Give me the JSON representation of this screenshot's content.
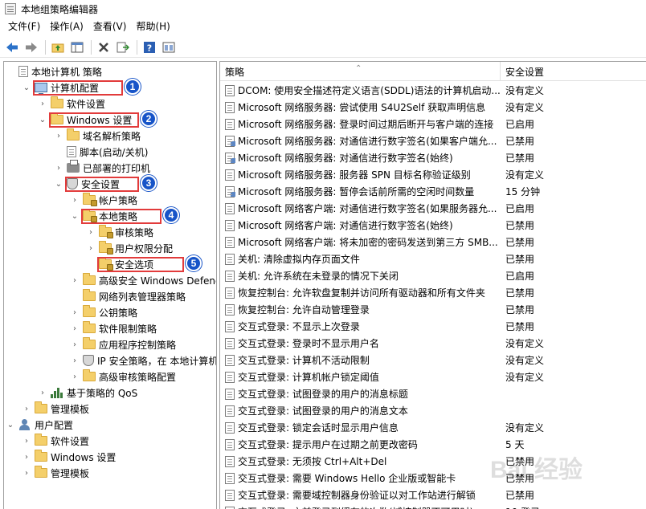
{
  "window": {
    "title": "本地组策略编辑器"
  },
  "menu": [
    "文件(F)",
    "操作(A)",
    "查看(V)",
    "帮助(H)"
  ],
  "toolbar": [
    "back-icon",
    "forward-icon",
    "up-folder-icon",
    "show-hide-tree-icon",
    "delete-icon",
    "export-icon",
    "help-icon",
    "properties-icon"
  ],
  "tree": [
    {
      "label": "本地计算机 策略",
      "icon": "doc-icon",
      "level": 0,
      "twisty": ""
    },
    {
      "label": "计算机配置",
      "icon": "pc-icon",
      "level": 1,
      "twisty": "open",
      "badge": "1"
    },
    {
      "label": "软件设置",
      "icon": "folder",
      "level": 2,
      "twisty": "closed"
    },
    {
      "label": "Windows 设置",
      "icon": "folder",
      "level": 2,
      "twisty": "open",
      "badge": "2"
    },
    {
      "label": "域名解析策略",
      "icon": "folder",
      "level": 3,
      "twisty": "closed"
    },
    {
      "label": "脚本(启动/关机)",
      "icon": "doc-icon",
      "level": 3,
      "twisty": ""
    },
    {
      "label": "已部署的打印机",
      "icon": "printer-icon",
      "level": 3,
      "twisty": "closed"
    },
    {
      "label": "安全设置",
      "icon": "shield-icon",
      "level": 3,
      "twisty": "open",
      "badge": "3"
    },
    {
      "label": "帐户策略",
      "icon": "folder-lock",
      "level": 4,
      "twisty": "closed"
    },
    {
      "label": "本地策略",
      "icon": "folder-lock",
      "level": 4,
      "twisty": "open",
      "badge": "4"
    },
    {
      "label": "审核策略",
      "icon": "folder-lock",
      "level": 5,
      "twisty": "closed"
    },
    {
      "label": "用户权限分配",
      "icon": "folder-lock",
      "level": 5,
      "twisty": "closed"
    },
    {
      "label": "安全选项",
      "icon": "folder-lock",
      "level": 5,
      "twisty": "",
      "badge": "5"
    },
    {
      "label": "高级安全 Windows Defender",
      "icon": "folder",
      "level": 4,
      "twisty": "closed"
    },
    {
      "label": "网络列表管理器策略",
      "icon": "folder",
      "level": 4,
      "twisty": ""
    },
    {
      "label": "公钥策略",
      "icon": "folder",
      "level": 4,
      "twisty": "closed"
    },
    {
      "label": "软件限制策略",
      "icon": "folder",
      "level": 4,
      "twisty": "closed"
    },
    {
      "label": "应用程序控制策略",
      "icon": "folder",
      "level": 4,
      "twisty": "closed"
    },
    {
      "label": "IP 安全策略，在 本地计算机",
      "icon": "shield-icon",
      "level": 4,
      "twisty": "closed"
    },
    {
      "label": "高级审核策略配置",
      "icon": "folder",
      "level": 4,
      "twisty": "closed"
    },
    {
      "label": "基于策略的 QoS",
      "icon": "chart-icon",
      "level": 2,
      "twisty": "closed"
    },
    {
      "label": "管理模板",
      "icon": "folder",
      "level": 1,
      "twisty": "closed"
    },
    {
      "label": "用户配置",
      "icon": "user-icon",
      "level": 0,
      "twisty": "open"
    },
    {
      "label": "软件设置",
      "icon": "folder",
      "level": 1,
      "twisty": "closed"
    },
    {
      "label": "Windows 设置",
      "icon": "folder",
      "level": 1,
      "twisty": "closed"
    },
    {
      "label": "管理模板",
      "icon": "folder",
      "level": 1,
      "twisty": "closed"
    }
  ],
  "list": {
    "headers": {
      "policy": "策略",
      "setting": "安全设置"
    },
    "rows": [
      {
        "policy": "DCOM: 使用安全描述符定义语言(SDDL)语法的计算机启动...",
        "setting": "没有定义"
      },
      {
        "policy": "Microsoft 网络服务器: 尝试使用 S4U2Self 获取声明信息",
        "setting": "没有定义"
      },
      {
        "policy": "Microsoft 网络服务器: 登录时间过期后断开与客户端的连接",
        "setting": "已启用"
      },
      {
        "policy": "Microsoft 网络服务器: 对通信进行数字签名(如果客户端允...",
        "setting": "已禁用"
      },
      {
        "policy": "Microsoft 网络服务器: 对通信进行数字签名(始终)",
        "setting": "已禁用"
      },
      {
        "policy": "Microsoft 网络服务器: 服务器 SPN 目标名称验证级别",
        "setting": "没有定义"
      },
      {
        "policy": "Microsoft 网络服务器: 暂停会话前所需的空闲时间数量",
        "setting": "15 分钟"
      },
      {
        "policy": "Microsoft 网络客户端: 对通信进行数字签名(如果服务器允...",
        "setting": "已启用"
      },
      {
        "policy": "Microsoft 网络客户端: 对通信进行数字签名(始终)",
        "setting": "已禁用"
      },
      {
        "policy": "Microsoft 网络客户端: 将未加密的密码发送到第三方 SMB...",
        "setting": "已禁用"
      },
      {
        "policy": "关机: 清除虚拟内存页面文件",
        "setting": "已禁用"
      },
      {
        "policy": "关机: 允许系统在未登录的情况下关闭",
        "setting": "已启用"
      },
      {
        "policy": "恢复控制台: 允许软盘复制并访问所有驱动器和所有文件夹",
        "setting": "已禁用"
      },
      {
        "policy": "恢复控制台: 允许自动管理登录",
        "setting": "已禁用"
      },
      {
        "policy": "交互式登录: 不显示上次登录",
        "setting": "已禁用"
      },
      {
        "policy": "交互式登录: 登录时不显示用户名",
        "setting": "没有定义"
      },
      {
        "policy": "交互式登录: 计算机不活动限制",
        "setting": "没有定义"
      },
      {
        "policy": "交互式登录: 计算机帐户锁定阈值",
        "setting": "没有定义"
      },
      {
        "policy": "交互式登录: 试图登录的用户的消息标题",
        "setting": ""
      },
      {
        "policy": "交互式登录: 试图登录的用户的消息文本",
        "setting": ""
      },
      {
        "policy": "交互式登录: 锁定会话时显示用户信息",
        "setting": "没有定义"
      },
      {
        "policy": "交互式登录: 提示用户在过期之前更改密码",
        "setting": "5 天"
      },
      {
        "policy": "交互式登录: 无须按 Ctrl+Alt+Del",
        "setting": "已禁用"
      },
      {
        "policy": "交互式登录: 需要 Windows Hello 企业版或智能卡",
        "setting": "已禁用"
      },
      {
        "policy": "交互式登录: 需要域控制器身份验证以对工作站进行解锁",
        "setting": "已禁用"
      },
      {
        "policy": "交互式登录: 之前登录到缓存的次数(域控制器不可用时)",
        "setting": "10 登录"
      }
    ]
  },
  "watermark": "Bai 经验",
  "colors": {
    "highlight_box": "#e23b3b",
    "badge": "#1754c8"
  }
}
